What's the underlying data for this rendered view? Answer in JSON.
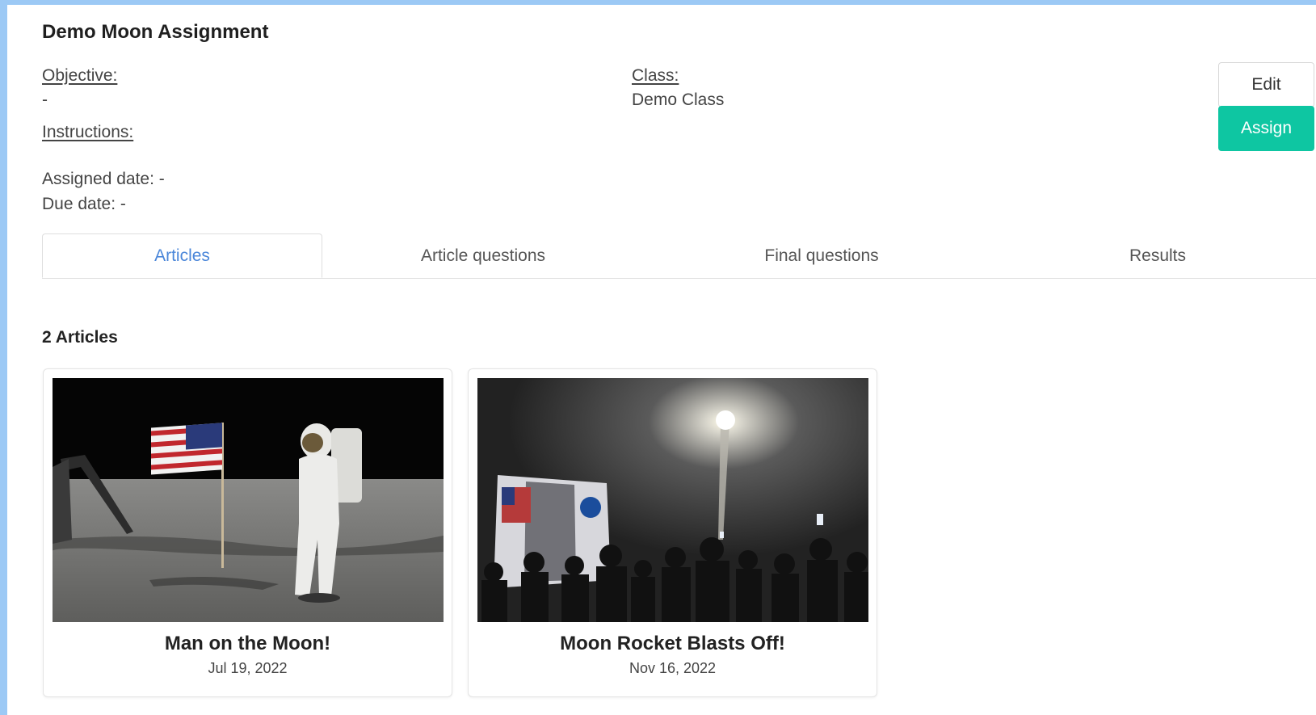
{
  "assignment": {
    "title": "Demo Moon Assignment",
    "objective_label": "Objective:",
    "objective_value": "-",
    "instructions_label": "Instructions:",
    "class_label": "Class:",
    "class_value": "Demo Class",
    "assigned_date": "Assigned date: -",
    "due_date": "Due date: -"
  },
  "actions": {
    "edit_label": "Edit",
    "assign_label": "Assign"
  },
  "tabs": [
    {
      "label": "Articles",
      "active": true
    },
    {
      "label": "Article questions",
      "active": false
    },
    {
      "label": "Final questions",
      "active": false
    },
    {
      "label": "Results",
      "active": false
    }
  ],
  "articles_count": "2 Articles",
  "articles": [
    {
      "title": "Man on the Moon!",
      "date": "Jul 19, 2022",
      "image": "astronaut-flag-moon-photo"
    },
    {
      "title": "Moon Rocket Blasts Off!",
      "date": "Nov 16, 2022",
      "image": "rocket-launch-crowd-photo"
    }
  ],
  "colors": {
    "accent": "#0ec6a2",
    "active_tab": "#4a86d9",
    "frame": "#9cc9f5"
  }
}
